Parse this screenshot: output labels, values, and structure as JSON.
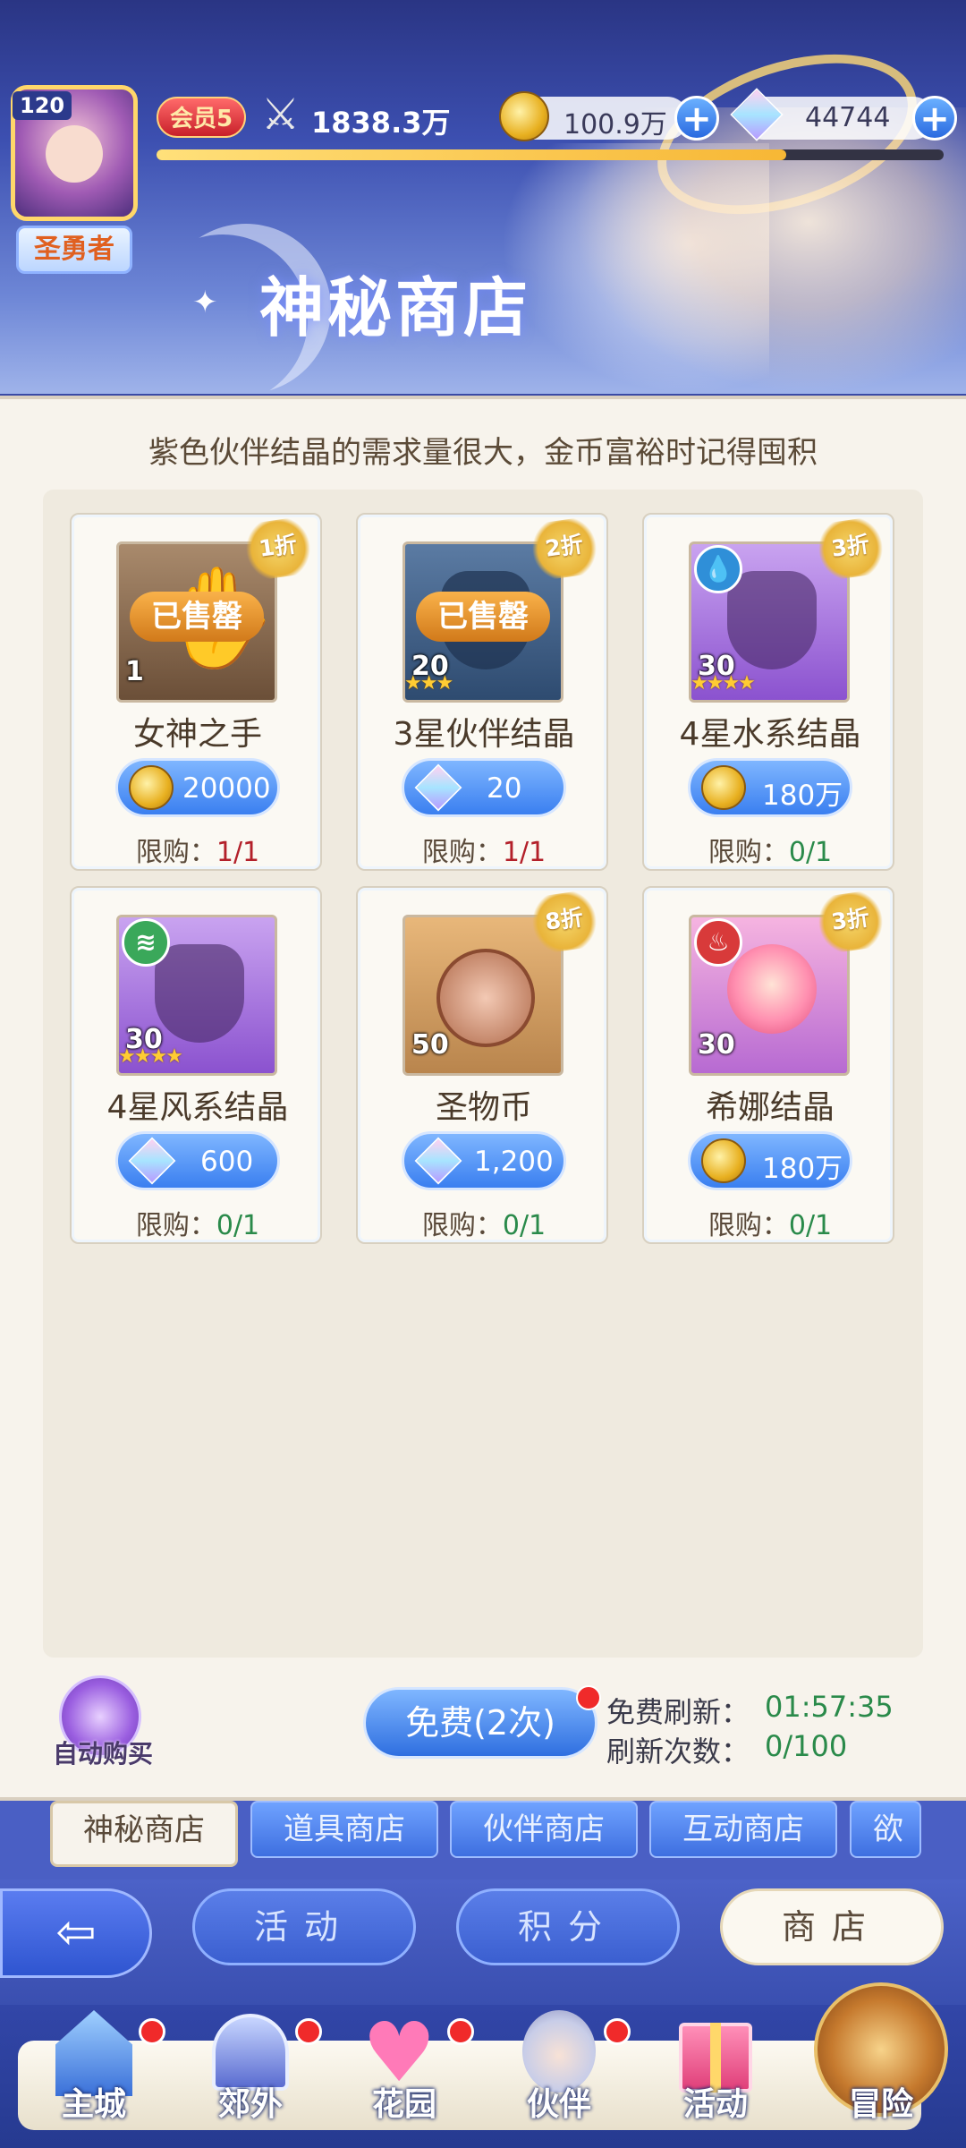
{
  "header": {
    "shop_title": "神秘商店",
    "level": "120",
    "player_title": "圣勇者",
    "vip": "会员5",
    "power": "1838.3万",
    "gold": "100.9万",
    "gems": "44744",
    "xp_progress": 0.8
  },
  "notice": "紫色伙伴结晶的需求量很大，金币富裕时记得囤积",
  "limit_label": "限购：",
  "items": [
    {
      "name": "女神之手",
      "qty": "1",
      "discount": "1折",
      "sold_out": "已售罄",
      "price": "20000",
      "currency": "gold",
      "limit": "1/1",
      "tile": "gold",
      "icon": "hand-icon"
    },
    {
      "name": "3星伙伴结晶",
      "qty": "20",
      "discount": "2折",
      "sold_out": "已售罄",
      "price": "20",
      "currency": "gem",
      "limit": "1/1",
      "tile": "blue",
      "stars": "★★★",
      "icon": "crystal-icon"
    },
    {
      "name": "4星水系结晶",
      "qty": "30",
      "discount": "3折",
      "price": "180万",
      "currency": "gold",
      "limit": "0/1",
      "tile": "purple",
      "stars": "★★★★",
      "element": "water",
      "icon": "crystal-icon"
    },
    {
      "name": "4星风系结晶",
      "qty": "30",
      "price": "600",
      "currency": "gem",
      "limit": "0/1",
      "tile": "purple",
      "stars": "★★★★",
      "element": "wind",
      "icon": "crystal-icon"
    },
    {
      "name": "圣物币",
      "qty": "50",
      "discount": "8折",
      "price": "1,200",
      "currency": "gem",
      "limit": "0/1",
      "tile": "bronze",
      "icon": "lips-coin-icon"
    },
    {
      "name": "希娜结晶",
      "qty": "30",
      "discount": "3折",
      "price": "180万",
      "currency": "gold",
      "limit": "0/1",
      "tile": "pink",
      "element": "fire",
      "icon": "character-crystal-icon"
    }
  ],
  "controls": {
    "auto_buy": "自动购买",
    "free_button": "免费(2次)",
    "free_refresh_label": "免费刷新：",
    "free_refresh_time": "01:57:35",
    "refresh_count_label": "刷新次数：",
    "refresh_count": "0/100"
  },
  "tabs": [
    "神秘商店",
    "道具商店",
    "伙伴商店",
    "互动商店",
    "欲望"
  ],
  "nav": {
    "back": "⇦",
    "activity": "活动",
    "points": "积分",
    "shop": "商店"
  },
  "bottom_nav": [
    "主城",
    "郊外",
    "花园",
    "伙伴",
    "活动",
    "冒险"
  ],
  "colors": {
    "accent": "#3a7ff0",
    "gold": "#e8b020",
    "limit_used": "#b3202a",
    "limit_free": "#2a8a4a"
  }
}
